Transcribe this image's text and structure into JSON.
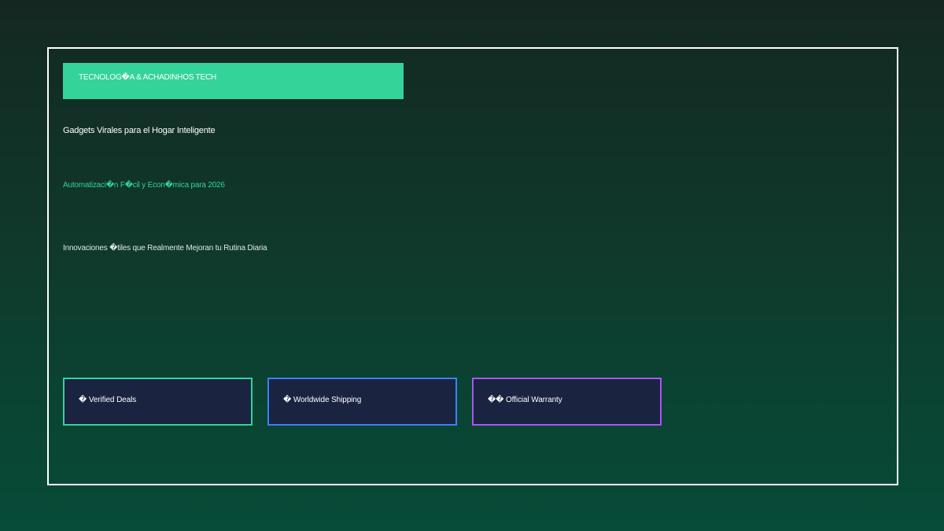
{
  "banner": {
    "label": "TECNOLOG�A & ACHADINHOS TECH"
  },
  "headline": "Gadgets Virales para el Hogar Inteligente",
  "subheadline": "Automatizaci�n F�cil y Econ�mica para 2026",
  "description": "Innovaciones �tiles que Realmente Mejoran tu Rutina Diaria",
  "features": [
    {
      "label": "� Verified Deals",
      "border_color": "#34d399"
    },
    {
      "label": "� Worldwide Shipping",
      "border_color": "#3b82f6"
    },
    {
      "label": "�� Official Warranty",
      "border_color": "#a855f7"
    }
  ],
  "colors": {
    "accent": "#34d399",
    "card_background": "#1a2340",
    "frame_border": "#ffffff"
  }
}
